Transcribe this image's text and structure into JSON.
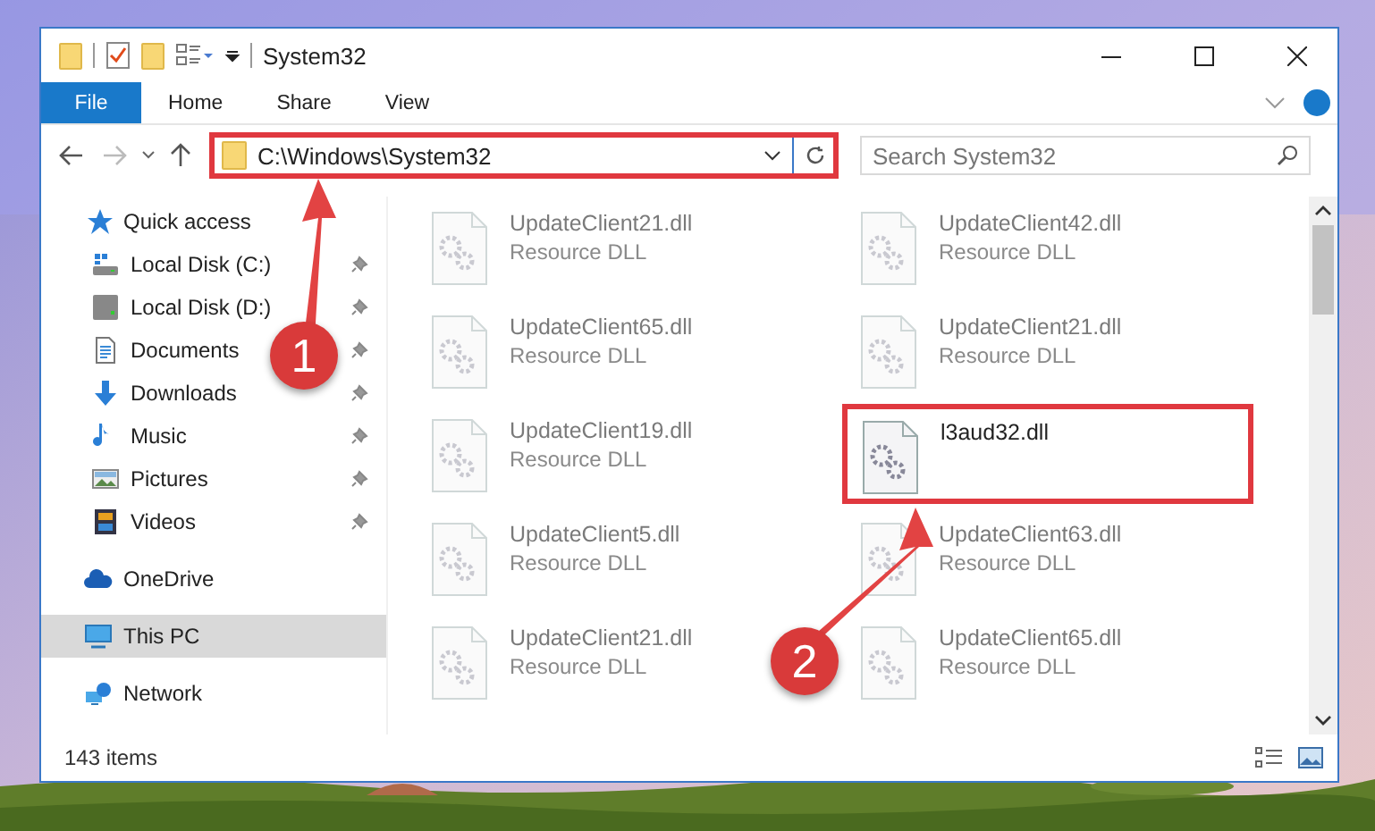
{
  "window": {
    "title": "System32"
  },
  "ribbon_tabs": [
    {
      "label": "File",
      "kind": "menu"
    },
    {
      "label": "Home",
      "kind": "tab"
    },
    {
      "label": "Share",
      "kind": "tab"
    },
    {
      "label": "View",
      "kind": "tab"
    }
  ],
  "address_bar": {
    "path": "C:\\Windows\\System32",
    "annotated": true
  },
  "search": {
    "placeholder": "Search System32"
  },
  "sidebar": [
    {
      "label": "Quick access",
      "selected": false,
      "children": [
        {
          "label": "Local Disk (C:)",
          "pinned": true
        },
        {
          "label": "Local Disk (D:)",
          "pinned": true
        },
        {
          "label": "Documents",
          "pinned": true
        },
        {
          "label": "Downloads",
          "pinned": true
        },
        {
          "label": "Music",
          "pinned": true
        },
        {
          "label": "Pictures",
          "pinned": true
        },
        {
          "label": "Videos",
          "pinned": true
        }
      ]
    },
    {
      "label": "OneDrive",
      "selected": false
    },
    {
      "label": "This PC",
      "selected": true
    },
    {
      "label": "Network",
      "selected": false
    }
  ],
  "files": [
    {
      "name": "UpdateClient21.dll",
      "type": "Resource DLL",
      "faded": true,
      "annotated": false
    },
    {
      "name": "UpdateClient42.dll",
      "type": "Resource DLL",
      "faded": true,
      "annotated": false
    },
    {
      "name": "UpdateClient65.dll",
      "type": "Resource DLL",
      "faded": true,
      "annotated": false
    },
    {
      "name": "UpdateClient21.dll",
      "type": "Resource DLL",
      "faded": true,
      "annotated": false
    },
    {
      "name": "UpdateClient19.dll",
      "type": "Resource DLL",
      "faded": true,
      "annotated": false
    },
    {
      "name": "l3aud32.dll",
      "faded": false,
      "annotated": true
    },
    {
      "name": "UpdateClient5.dll",
      "type": "Resource DLL",
      "faded": true,
      "annotated": false
    },
    {
      "name": "UpdateClient63.dll",
      "type": "Resource DLL",
      "faded": true,
      "annotated": false
    },
    {
      "name": "UpdateClient21.dll",
      "type": "Resource DLL",
      "faded": true,
      "annotated": false
    },
    {
      "name": "UpdateClient65.dll",
      "type": "Resource DLL",
      "faded": true,
      "annotated": false
    }
  ],
  "status_bar": {
    "items": "143 items"
  },
  "callouts": [
    {
      "number": "1"
    },
    {
      "number": "2"
    }
  ]
}
